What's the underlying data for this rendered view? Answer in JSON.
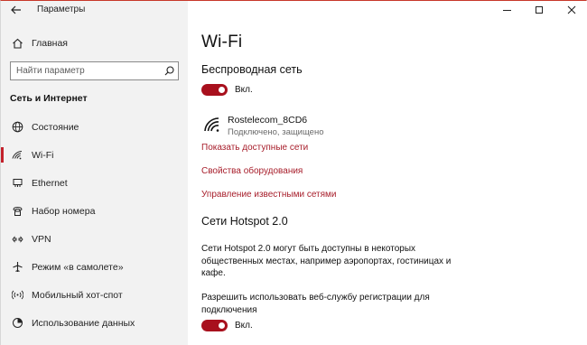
{
  "window": {
    "title": "Параметры",
    "controls": {
      "minimize": "minimize",
      "maximize": "maximize",
      "close": "close"
    }
  },
  "sidebar": {
    "home_label": "Главная",
    "search_placeholder": "Найти параметр",
    "section_title": "Сеть и Интернет",
    "items": [
      {
        "label": "Состояние",
        "icon": "globe-icon"
      },
      {
        "label": "Wi-Fi",
        "icon": "wifi-icon",
        "active": true
      },
      {
        "label": "Ethernet",
        "icon": "ethernet-icon"
      },
      {
        "label": "Набор номера",
        "icon": "phone-icon"
      },
      {
        "label": "VPN",
        "icon": "vpn-icon"
      },
      {
        "label": "Режим «в самолете»",
        "icon": "airplane-icon"
      },
      {
        "label": "Мобильный хот-спот",
        "icon": "hotspot-icon"
      },
      {
        "label": "Использование данных",
        "icon": "data-usage-icon"
      }
    ]
  },
  "main": {
    "title": "Wi-Fi",
    "wireless_heading": "Беспроводная сеть",
    "wireless_toggle_label": "Вкл.",
    "network": {
      "name": "Rostelecom_8CD6",
      "status": "Подключено, защищено"
    },
    "links": {
      "show_networks": "Показать доступные сети",
      "hardware_props": "Свойства оборудования",
      "manage_known": "Управление известными сетями"
    },
    "hotspot_heading": "Сети Hotspot 2.0",
    "hotspot_desc": "Сети Hotspot 2.0 могут быть доступны в некоторых общественных местах, например аэропортах, гостиницах и кафе.",
    "registration_desc": "Разрешить использовать веб-службу регистрации для подключения",
    "registration_toggle_label": "Вкл."
  },
  "colors": {
    "accent": "#a8101d",
    "link": "#a71d2a",
    "sidebar_bg": "#f2f2f2"
  }
}
